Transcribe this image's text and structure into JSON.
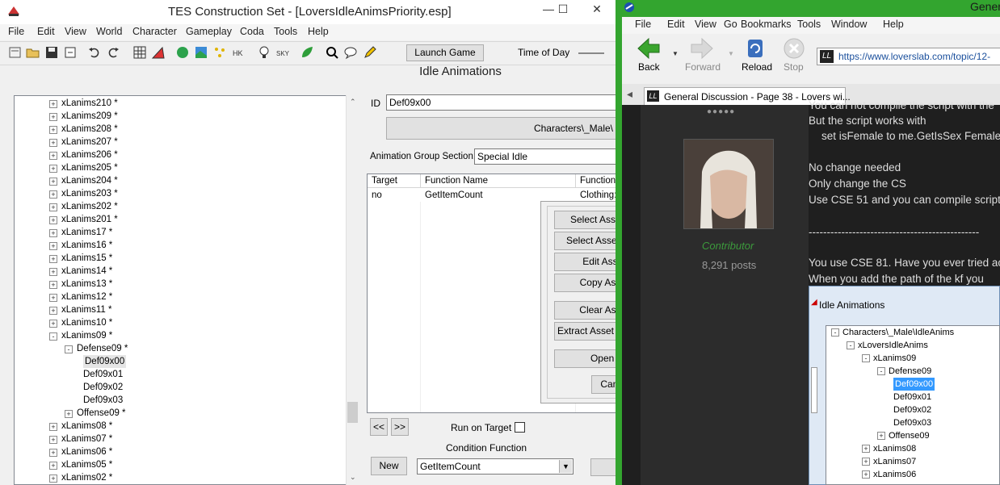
{
  "cs": {
    "title": "TES Construction Set - [LoversIdleAnimsPriority.esp]",
    "menu": [
      "File",
      "Edit",
      "View",
      "World",
      "Character",
      "Gameplay",
      "Coda",
      "Tools",
      "Help"
    ],
    "launch_game": "Launch Game",
    "time_of_day": "Time of Day",
    "dialog_title": "Idle Animations",
    "tree": {
      "items": [
        {
          "label": "xLanims210 *",
          "sign": "+"
        },
        {
          "label": "xLanims209 *",
          "sign": "+"
        },
        {
          "label": "xLanims208 *",
          "sign": "+"
        },
        {
          "label": "xLanims207 *",
          "sign": "+"
        },
        {
          "label": "xLanims206 *",
          "sign": "+"
        },
        {
          "label": "xLanims205 *",
          "sign": "+"
        },
        {
          "label": "xLanims204 *",
          "sign": "+"
        },
        {
          "label": "xLanims203 *",
          "sign": "+"
        },
        {
          "label": "xLanims202 *",
          "sign": "+"
        },
        {
          "label": "xLanims201 *",
          "sign": "+"
        },
        {
          "label": "xLanims17 *",
          "sign": "+"
        },
        {
          "label": "xLanims16 *",
          "sign": "+"
        },
        {
          "label": "xLanims15 *",
          "sign": "+"
        },
        {
          "label": "xLanims14 *",
          "sign": "+"
        },
        {
          "label": "xLanims13 *",
          "sign": "+"
        },
        {
          "label": "xLanims12 *",
          "sign": "+"
        },
        {
          "label": "xLanims11 *",
          "sign": "+"
        },
        {
          "label": "xLanims10 *",
          "sign": "+"
        },
        {
          "label": "xLanims09 *",
          "sign": "-"
        },
        {
          "label": "Defense09 *",
          "sign": "-"
        },
        {
          "label": "Def09x00",
          "sign": ""
        },
        {
          "label": "Def09x01",
          "sign": ""
        },
        {
          "label": "Def09x02",
          "sign": ""
        },
        {
          "label": "Def09x03",
          "sign": ""
        },
        {
          "label": "Offense09 *",
          "sign": "+"
        },
        {
          "label": "xLanims08 *",
          "sign": "+"
        },
        {
          "label": "xLanims07 *",
          "sign": "+"
        },
        {
          "label": "xLanims06 *",
          "sign": "+"
        },
        {
          "label": "xLanims05 *",
          "sign": "+"
        },
        {
          "label": "xLanims02 *",
          "sign": "+"
        }
      ]
    },
    "id_label": "ID",
    "id_value": "Def09x00",
    "path_button": "Characters\\_Male\\",
    "anim_group_label": "Animation Group Section:",
    "anim_group_value": "Special Idle",
    "table": {
      "headers": [
        "Target",
        "Function Name",
        "Function"
      ],
      "row": [
        "no",
        "GetItemCount",
        "Clothing:"
      ]
    },
    "prev_button": "<<",
    "next_button": ">>",
    "run_on_target": "Run on Target",
    "condition_function_label": "Condition Function",
    "new_button": "New",
    "condition_function_value": "GetItemCount"
  },
  "popup": {
    "buttons": [
      "Select Asset On Disk",
      "Select Asset In Archive",
      "Edit Asset Path",
      "Copy Asset Path",
      "Clear Asset Path",
      "Extract Asset From Archive",
      "Open Asset",
      "Cancel"
    ]
  },
  "browser": {
    "title_partial": "Gener",
    "menu": [
      "File",
      "Edit",
      "View",
      "Go",
      "Bookmarks",
      "Tools",
      "Window",
      "Help"
    ],
    "back": "Back",
    "forward": "Forward",
    "reload": "Reload",
    "stop": "Stop",
    "url": "https://www.loverslab.com/topic/12-",
    "tab_title": "General Discussion - Page 38 - Lovers wi...",
    "post": {
      "role": "Contributor",
      "posts": "8,291 posts",
      "lines": [
        "You can not compile the script with the",
        "But the script works with",
        "set isFemale to me.GetIsSex Female",
        "",
        "No change needed",
        "Only change the CS",
        "Use CSE 51 and you can compile script",
        "",
        "-----------------------------------------------",
        "",
        "You use CSE 81. Have you ever tried ac",
        "When you  add the path of the kf  you"
      ]
    },
    "idle_window": {
      "title": "Idle Animations",
      "items": [
        {
          "label": "Characters\\_Male\\IdleAnims",
          "sign": "-"
        },
        {
          "label": "xLoversIdleAnims",
          "sign": "-"
        },
        {
          "label": "xLanims09",
          "sign": "-"
        },
        {
          "label": "Defense09",
          "sign": "-"
        },
        {
          "label": "Def09x00",
          "sign": ""
        },
        {
          "label": "Def09x01",
          "sign": ""
        },
        {
          "label": "Def09x02",
          "sign": ""
        },
        {
          "label": "Def09x03",
          "sign": ""
        },
        {
          "label": "Offense09",
          "sign": "+"
        },
        {
          "label": "xLanims08",
          "sign": "+"
        },
        {
          "label": "xLanims07",
          "sign": "+"
        },
        {
          "label": "xLanims06",
          "sign": "+"
        }
      ]
    }
  },
  "colors": {
    "browser_frame": "#33a52f",
    "forum_bg": "#1f1f1f",
    "contributor": "#3c9a3c",
    "selection": "#3399ff"
  }
}
